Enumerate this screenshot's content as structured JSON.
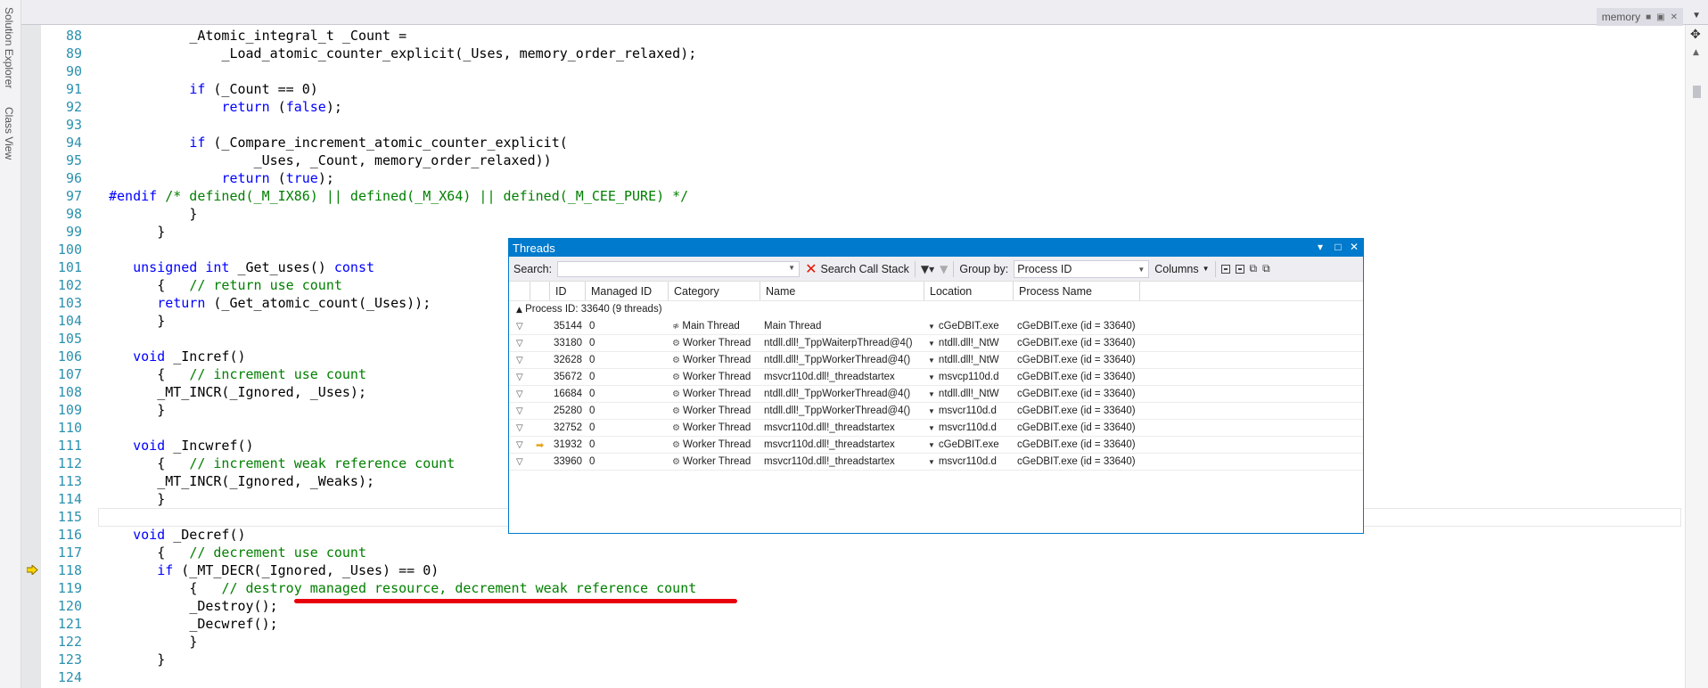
{
  "side_tabs": [
    "Solution Explorer",
    "Class View"
  ],
  "doc_tab": {
    "name": "memory"
  },
  "editor": {
    "lines": [
      {
        "num": "88",
        "indent": "          ",
        "segs": [
          {
            "t": "_Atomic_integral_t _Count =",
            "c": ""
          }
        ]
      },
      {
        "num": "89",
        "indent": "              ",
        "segs": [
          {
            "t": "_Load_atomic_counter_explicit(_Uses, memory_order_relaxed);",
            "c": ""
          }
        ]
      },
      {
        "num": "90",
        "indent": "",
        "segs": []
      },
      {
        "num": "91",
        "indent": "          ",
        "segs": [
          {
            "t": "if",
            "c": "kw"
          },
          {
            "t": " (_Count == 0)",
            "c": ""
          }
        ]
      },
      {
        "num": "92",
        "indent": "              ",
        "segs": [
          {
            "t": "return",
            "c": "kw"
          },
          {
            "t": " (",
            "c": ""
          },
          {
            "t": "false",
            "c": "kw"
          },
          {
            "t": ");",
            "c": ""
          }
        ]
      },
      {
        "num": "93",
        "indent": "",
        "segs": []
      },
      {
        "num": "94",
        "indent": "          ",
        "segs": [
          {
            "t": "if",
            "c": "kw"
          },
          {
            "t": " (_Compare_increment_atomic_counter_explicit(",
            "c": ""
          }
        ]
      },
      {
        "num": "95",
        "indent": "                  ",
        "segs": [
          {
            "t": "_Uses, _Count, memory_order_relaxed))",
            "c": ""
          }
        ]
      },
      {
        "num": "96",
        "indent": "              ",
        "segs": [
          {
            "t": "return",
            "c": "kw"
          },
          {
            "t": " (",
            "c": ""
          },
          {
            "t": "true",
            "c": "kw"
          },
          {
            "t": ");",
            "c": ""
          }
        ]
      },
      {
        "num": "97",
        "indent": "",
        "segs": [
          {
            "t": "#endif",
            "c": "kw"
          },
          {
            "t": " /* defined(_M_IX86) || defined(_M_X64) || defined(_M_CEE_PURE) */",
            "c": "cm"
          }
        ]
      },
      {
        "num": "98",
        "indent": "          ",
        "segs": [
          {
            "t": "}",
            "c": ""
          }
        ]
      },
      {
        "num": "99",
        "indent": "      ",
        "segs": [
          {
            "t": "}",
            "c": ""
          }
        ]
      },
      {
        "num": "100",
        "indent": "",
        "segs": []
      },
      {
        "num": "101",
        "indent": "   ",
        "segs": [
          {
            "t": "unsigned int",
            "c": "kw"
          },
          {
            "t": " _Get_uses() ",
            "c": ""
          },
          {
            "t": "const",
            "c": "kw"
          }
        ]
      },
      {
        "num": "102",
        "indent": "      ",
        "segs": [
          {
            "t": "{   ",
            "c": ""
          },
          {
            "t": "// return use count",
            "c": "cm"
          }
        ]
      },
      {
        "num": "103",
        "indent": "      ",
        "segs": [
          {
            "t": "return",
            "c": "kw"
          },
          {
            "t": " (_Get_atomic_count(_Uses));",
            "c": ""
          }
        ]
      },
      {
        "num": "104",
        "indent": "      ",
        "segs": [
          {
            "t": "}",
            "c": ""
          }
        ]
      },
      {
        "num": "105",
        "indent": "",
        "segs": []
      },
      {
        "num": "106",
        "indent": "   ",
        "segs": [
          {
            "t": "void",
            "c": "kw"
          },
          {
            "t": " _Incref()",
            "c": ""
          }
        ]
      },
      {
        "num": "107",
        "indent": "      ",
        "segs": [
          {
            "t": "{   ",
            "c": ""
          },
          {
            "t": "// increment use count",
            "c": "cm"
          }
        ]
      },
      {
        "num": "108",
        "indent": "      ",
        "segs": [
          {
            "t": "_MT_INCR(_Ignored, _Uses);",
            "c": ""
          }
        ]
      },
      {
        "num": "109",
        "indent": "      ",
        "segs": [
          {
            "t": "}",
            "c": ""
          }
        ]
      },
      {
        "num": "110",
        "indent": "",
        "segs": []
      },
      {
        "num": "111",
        "indent": "   ",
        "segs": [
          {
            "t": "void",
            "c": "kw"
          },
          {
            "t": " _Incwref()",
            "c": ""
          }
        ]
      },
      {
        "num": "112",
        "indent": "      ",
        "segs": [
          {
            "t": "{   ",
            "c": ""
          },
          {
            "t": "// increment weak reference count",
            "c": "cm"
          }
        ]
      },
      {
        "num": "113",
        "indent": "      ",
        "segs": [
          {
            "t": "_MT_INCR(_Ignored, _Weaks);",
            "c": ""
          }
        ]
      },
      {
        "num": "114",
        "indent": "      ",
        "segs": [
          {
            "t": "}",
            "c": ""
          }
        ]
      },
      {
        "num": "115",
        "indent": "",
        "segs": [],
        "current": true
      },
      {
        "num": "116",
        "indent": "   ",
        "segs": [
          {
            "t": "void",
            "c": "kw"
          },
          {
            "t": " _Decref()",
            "c": ""
          }
        ]
      },
      {
        "num": "117",
        "indent": "      ",
        "segs": [
          {
            "t": "{   ",
            "c": ""
          },
          {
            "t": "// decrement use count",
            "c": "cm"
          }
        ]
      },
      {
        "num": "118",
        "indent": "      ",
        "segs": [
          {
            "t": "if",
            "c": "kw"
          },
          {
            "t": " (_MT_DECR(_Ignored, _Uses) == 0)",
            "c": ""
          }
        ]
      },
      {
        "num": "119",
        "indent": "          ",
        "segs": [
          {
            "t": "{   ",
            "c": ""
          },
          {
            "t": "// destroy managed resource, decrement weak reference count",
            "c": "cm"
          }
        ]
      },
      {
        "num": "120",
        "indent": "          ",
        "segs": [
          {
            "t": "_Destroy();",
            "c": ""
          }
        ]
      },
      {
        "num": "121",
        "indent": "          ",
        "segs": [
          {
            "t": "_Decwref();",
            "c": ""
          }
        ]
      },
      {
        "num": "122",
        "indent": "          ",
        "segs": [
          {
            "t": "}",
            "c": ""
          }
        ]
      },
      {
        "num": "123",
        "indent": "      ",
        "segs": [
          {
            "t": "}",
            "c": ""
          }
        ]
      },
      {
        "num": "124",
        "indent": "",
        "segs": []
      }
    ]
  },
  "threads": {
    "title": "Threads",
    "toolbar": {
      "search_label": "Search:",
      "search_value": "",
      "search_call_stack": "Search Call Stack",
      "group_by_label": "Group by:",
      "group_by_value": "Process ID",
      "columns_label": "Columns"
    },
    "columns": [
      "ID",
      "Managed ID",
      "Category",
      "Name",
      "Location",
      "Process Name"
    ],
    "group_label": "Process ID: 33640  (9 threads)",
    "rows": [
      {
        "id": "35144",
        "managed": "0",
        "category": "Main Thread",
        "name": "Main Thread",
        "location": "cGeDBIT.exe",
        "process": "cGeDBIT.exe (id = 33640)",
        "current": false,
        "main": true
      },
      {
        "id": "33180",
        "managed": "0",
        "category": "Worker Thread",
        "name": "ntdll.dll!_TppWaiterpThread@4()",
        "location": "ntdll.dll!_NtW",
        "process": "cGeDBIT.exe (id = 33640)",
        "current": false,
        "main": false
      },
      {
        "id": "32628",
        "managed": "0",
        "category": "Worker Thread",
        "name": "ntdll.dll!_TppWorkerThread@4()",
        "location": "ntdll.dll!_NtW",
        "process": "cGeDBIT.exe (id = 33640)",
        "current": false,
        "main": false
      },
      {
        "id": "35672",
        "managed": "0",
        "category": "Worker Thread",
        "name": "msvcr110d.dll!_threadstartex",
        "location": "msvcp110d.d",
        "process": "cGeDBIT.exe (id = 33640)",
        "current": false,
        "main": false
      },
      {
        "id": "16684",
        "managed": "0",
        "category": "Worker Thread",
        "name": "ntdll.dll!_TppWorkerThread@4()",
        "location": "ntdll.dll!_NtW",
        "process": "cGeDBIT.exe (id = 33640)",
        "current": false,
        "main": false
      },
      {
        "id": "25280",
        "managed": "0",
        "category": "Worker Thread",
        "name": "ntdll.dll!_TppWorkerThread@4()",
        "location": "msvcr110d.d",
        "process": "cGeDBIT.exe (id = 33640)",
        "current": false,
        "main": false
      },
      {
        "id": "32752",
        "managed": "0",
        "category": "Worker Thread",
        "name": "msvcr110d.dll!_threadstartex",
        "location": "msvcr110d.d",
        "process": "cGeDBIT.exe (id = 33640)",
        "current": false,
        "main": false
      },
      {
        "id": "31932",
        "managed": "0",
        "category": "Worker Thread",
        "name": "msvcr110d.dll!_threadstartex",
        "location": "cGeDBIT.exe",
        "process": "cGeDBIT.exe (id = 33640)",
        "current": true,
        "main": false
      },
      {
        "id": "33960",
        "managed": "0",
        "category": "Worker Thread",
        "name": "msvcr110d.dll!_threadstartex",
        "location": "msvcr110d.d",
        "process": "cGeDBIT.exe (id = 33640)",
        "current": false,
        "main": false
      }
    ]
  },
  "colors": {
    "keyword": "#0000ff",
    "comment": "#008000",
    "line_number": "#2b91af",
    "accent": "#007acc",
    "annotation": "#e8000b"
  }
}
